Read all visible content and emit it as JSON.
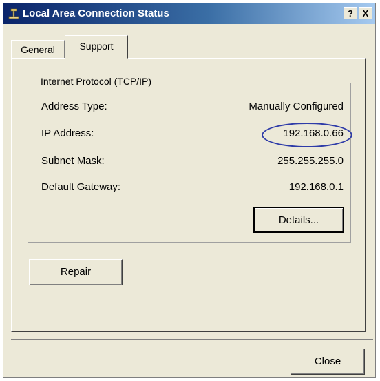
{
  "window": {
    "title": "Local Area Connection Status",
    "help_label": "?",
    "close_label": "X"
  },
  "tabs": [
    {
      "label": "General"
    },
    {
      "label": "Support"
    }
  ],
  "group": {
    "label": "Internet Protocol (TCP/IP)",
    "rows": [
      {
        "label": "Address Type:",
        "value": "Manually Configured"
      },
      {
        "label": "IP Address:",
        "value": "192.168.0.66"
      },
      {
        "label": "Subnet Mask:",
        "value": "255.255.255.0"
      },
      {
        "label": "Default Gateway:",
        "value": "192.168.0.1"
      }
    ],
    "details_label": "Details..."
  },
  "repair_label": "Repair",
  "close_button_label": "Close",
  "colors": {
    "titlebar_start": "#0a246a",
    "titlebar_end": "#a6caf0",
    "dialog_bg": "#ECE9D8",
    "highlight_circle": "#2e3ba8"
  },
  "icons": {
    "title": "network-connection-icon"
  }
}
